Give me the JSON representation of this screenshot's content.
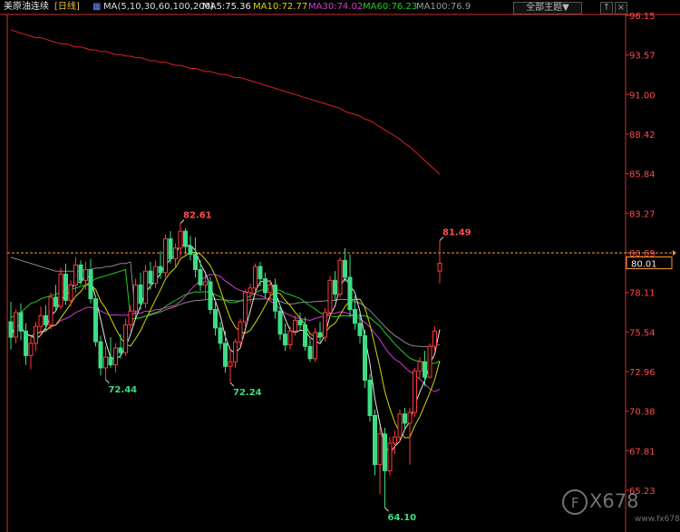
{
  "header": {
    "symbol": "美原油连续",
    "period": "[日线]",
    "ma_label": "MA(5,10,30,60,100,200)",
    "ma5": "MA5:75.36",
    "ma10": "MA10:72.77",
    "ma30": "MA30:74.02",
    "ma60": "MA60:76.23",
    "ma100": "MA100:76.9",
    "dropdown": "全部主题▼",
    "btn_up": "↑",
    "btn_x": "×"
  },
  "colors": {
    "up": "#ff3a3a",
    "down": "#3ddc84",
    "ma5": "#e8e8e8",
    "ma10": "#d6d600",
    "ma30": "#d23cd2",
    "ma60": "#22cc22",
    "ma100": "#8a8a8a",
    "ma200": "#e02020",
    "axis": "#c83232",
    "ref_line": "#ff9a2e",
    "hi_label": "#ff5050",
    "lo_label": "#3ddc84"
  },
  "watermark": {
    "brand": "X678",
    "url": "www.fx678.com"
  },
  "chart_data": {
    "type": "candlestick",
    "title": "美原油连续 [日线]",
    "ylim": [
      64.1,
      96.15
    ],
    "y_ticks": [
      96.15,
      93.57,
      91.0,
      88.42,
      85.84,
      83.27,
      80.69,
      78.11,
      75.54,
      72.96,
      70.38,
      67.81,
      65.23
    ],
    "current_price": 80.01,
    "reference_line": 80.69,
    "reference_line_label": "80.69",
    "annotations": [
      {
        "text": "82.61",
        "value": 82.61,
        "kind": "high"
      },
      {
        "text": "72.44",
        "value": 72.44,
        "kind": "low"
      },
      {
        "text": "72.24",
        "value": 72.24,
        "kind": "low"
      },
      {
        "text": "64.10",
        "value": 64.1,
        "kind": "low"
      },
      {
        "text": "81.49",
        "value": 81.49,
        "kind": "high"
      }
    ],
    "ohlc": [
      [
        76.2,
        77.5,
        74.4,
        75.2
      ],
      [
        75.2,
        77.0,
        74.8,
        76.8
      ],
      [
        76.8,
        77.4,
        75.0,
        75.6
      ],
      [
        75.6,
        76.1,
        73.4,
        74.0
      ],
      [
        74.0,
        75.2,
        73.1,
        74.8
      ],
      [
        74.8,
        76.2,
        74.3,
        75.9
      ],
      [
        75.9,
        77.2,
        75.3,
        76.6
      ],
      [
        76.6,
        77.3,
        75.6,
        76.0
      ],
      [
        76.0,
        78.1,
        75.7,
        77.8
      ],
      [
        77.8,
        78.6,
        76.9,
        77.2
      ],
      [
        77.2,
        79.7,
        77.0,
        79.3
      ],
      [
        79.3,
        80.0,
        77.3,
        77.6
      ],
      [
        77.6,
        78.9,
        77.2,
        78.6
      ],
      [
        78.6,
        80.4,
        78.1,
        79.9
      ],
      [
        79.9,
        80.2,
        78.6,
        78.9
      ],
      [
        78.9,
        80.1,
        78.3,
        79.6
      ],
      [
        79.6,
        80.3,
        77.4,
        77.7
      ],
      [
        77.7,
        77.9,
        74.6,
        74.9
      ],
      [
        74.9,
        75.3,
        72.7,
        73.2
      ],
      [
        73.2,
        74.6,
        72.44,
        73.9
      ],
      [
        73.9,
        75.2,
        73.2,
        73.4
      ],
      [
        73.4,
        74.8,
        72.9,
        74.5
      ],
      [
        74.5,
        75.4,
        73.8,
        74.2
      ],
      [
        74.2,
        76.4,
        74.0,
        76.0
      ],
      [
        76.0,
        77.3,
        75.6,
        76.9
      ],
      [
        76.9,
        79.0,
        76.6,
        78.6
      ],
      [
        78.6,
        79.4,
        77.0,
        77.4
      ],
      [
        77.4,
        79.9,
        77.1,
        79.5
      ],
      [
        79.5,
        80.1,
        78.3,
        78.7
      ],
      [
        78.7,
        80.2,
        78.4,
        79.8
      ],
      [
        79.8,
        80.8,
        79.0,
        79.4
      ],
      [
        79.4,
        81.9,
        79.1,
        81.6
      ],
      [
        81.6,
        82.1,
        80.0,
        80.3
      ],
      [
        80.3,
        81.3,
        79.8,
        81.0
      ],
      [
        81.0,
        82.61,
        80.4,
        82.1
      ],
      [
        82.1,
        82.3,
        80.6,
        81.1
      ],
      [
        81.1,
        81.8,
        80.2,
        80.6
      ],
      [
        80.6,
        81.7,
        79.1,
        79.6
      ],
      [
        79.6,
        80.2,
        78.2,
        78.6
      ],
      [
        78.6,
        79.3,
        77.6,
        78.8
      ],
      [
        78.8,
        79.1,
        76.7,
        77.0
      ],
      [
        77.0,
        77.6,
        75.3,
        75.8
      ],
      [
        75.8,
        76.2,
        74.4,
        74.8
      ],
      [
        74.8,
        75.6,
        72.9,
        73.3
      ],
      [
        73.3,
        74.4,
        72.24,
        73.6
      ],
      [
        73.6,
        75.1,
        73.2,
        74.9
      ],
      [
        74.9,
        76.4,
        74.6,
        76.2
      ],
      [
        76.2,
        78.3,
        75.9,
        78.1
      ],
      [
        78.1,
        78.7,
        77.4,
        78.4
      ],
      [
        78.4,
        80.0,
        78.1,
        79.8
      ],
      [
        79.8,
        80.1,
        78.5,
        79.0
      ],
      [
        79.0,
        79.4,
        77.8,
        78.1
      ],
      [
        78.1,
        78.9,
        77.7,
        78.6
      ],
      [
        78.6,
        79.0,
        76.4,
        76.9
      ],
      [
        76.9,
        77.3,
        75.0,
        75.4
      ],
      [
        75.4,
        76.1,
        74.3,
        74.7
      ],
      [
        74.7,
        75.9,
        74.4,
        75.6
      ],
      [
        75.6,
        76.6,
        75.3,
        76.3
      ],
      [
        76.3,
        76.8,
        75.6,
        76.0
      ],
      [
        76.0,
        76.5,
        74.3,
        74.6
      ],
      [
        74.6,
        75.1,
        73.6,
        73.8
      ],
      [
        73.8,
        75.8,
        73.6,
        75.5
      ],
      [
        75.5,
        76.2,
        74.9,
        75.2
      ],
      [
        75.2,
        77.1,
        74.9,
        76.8
      ],
      [
        76.8,
        79.2,
        76.5,
        78.9
      ],
      [
        78.9,
        79.5,
        77.6,
        78.0
      ],
      [
        78.0,
        80.4,
        77.8,
        80.2
      ],
      [
        80.2,
        81.0,
        78.8,
        79.1
      ],
      [
        79.1,
        80.6,
        76.5,
        77.0
      ],
      [
        77.0,
        77.9,
        75.7,
        76.1
      ],
      [
        76.1,
        76.8,
        74.8,
        75.3
      ],
      [
        75.3,
        75.7,
        71.9,
        72.4
      ],
      [
        72.4,
        72.8,
        69.7,
        70.1
      ],
      [
        70.1,
        70.5,
        66.2,
        66.9
      ],
      [
        66.9,
        69.4,
        65.0,
        68.9
      ],
      [
        68.9,
        69.3,
        64.1,
        66.5
      ],
      [
        66.5,
        68.7,
        66.2,
        68.3
      ],
      [
        68.3,
        69.1,
        67.6,
        68.7
      ],
      [
        68.7,
        70.5,
        68.4,
        70.2
      ],
      [
        70.2,
        70.6,
        69.2,
        69.6
      ],
      [
        69.6,
        70.6,
        66.9,
        70.3
      ],
      [
        70.3,
        73.2,
        70.0,
        73.0
      ],
      [
        73.0,
        73.9,
        72.5,
        73.6
      ],
      [
        73.6,
        74.3,
        72.0,
        72.6
      ],
      [
        72.6,
        74.8,
        72.5,
        74.6
      ],
      [
        74.6,
        75.9,
        74.3,
        75.6
      ],
      [
        79.5,
        81.49,
        78.7,
        80.01
      ]
    ],
    "ma_series": [
      {
        "name": "MA5",
        "last": 75.36
      },
      {
        "name": "MA10",
        "last": 72.77
      },
      {
        "name": "MA30",
        "last": 74.02
      },
      {
        "name": "MA60",
        "last": 76.23
      },
      {
        "name": "MA100",
        "last": 76.9
      },
      {
        "name": "MA200"
      }
    ],
    "ma60_start": [
      76.5,
      76.6,
      76.8,
      77.1,
      77.4,
      77.5,
      77.7,
      77.8,
      77.9,
      78.0,
      78.1,
      78.2,
      78.3,
      78.4,
      78.5,
      78.6,
      78.8,
      79.0,
      79.1,
      79.2,
      79.3,
      79.4,
      79.5,
      79.6
    ],
    "ma100_start": [
      80.4,
      80.3,
      80.2,
      80.1,
      80.0,
      79.9,
      79.8,
      79.7,
      79.6,
      79.5,
      79.5,
      79.5,
      79.5,
      79.5,
      79.5,
      79.6,
      79.6,
      79.7,
      79.7,
      79.8,
      79.8,
      79.9,
      80.0,
      80.0,
      80.1
    ],
    "ma200_start": [
      95.2,
      95.1,
      95.0,
      94.9,
      94.8,
      94.7,
      94.7,
      94.6,
      94.5,
      94.4,
      94.3,
      94.3,
      94.2,
      94.1,
      94.1,
      94.0,
      93.9,
      93.9,
      93.8,
      93.8,
      93.7,
      93.6,
      93.6,
      93.5,
      93.5,
      93.4,
      93.4,
      93.3,
      93.2,
      93.2,
      93.1,
      93.1,
      93.0,
      92.9,
      92.9,
      92.8,
      92.7,
      92.7,
      92.6,
      92.5,
      92.5,
      92.4,
      92.3,
      92.3,
      92.2,
      92.1,
      92.1,
      92.0,
      91.9,
      91.8,
      91.7,
      91.6,
      91.5,
      91.4,
      91.3,
      91.2,
      91.1,
      91.0,
      90.9,
      90.8,
      90.7,
      90.6,
      90.5,
      90.4,
      90.3,
      90.2,
      90.1,
      89.9,
      89.8,
      89.7,
      89.6,
      89.4,
      89.3,
      89.1,
      88.9,
      88.7,
      88.5,
      88.3,
      88.1,
      87.8,
      87.6,
      87.3,
      87.0,
      86.7,
      86.4,
      86.1,
      85.8
    ]
  }
}
